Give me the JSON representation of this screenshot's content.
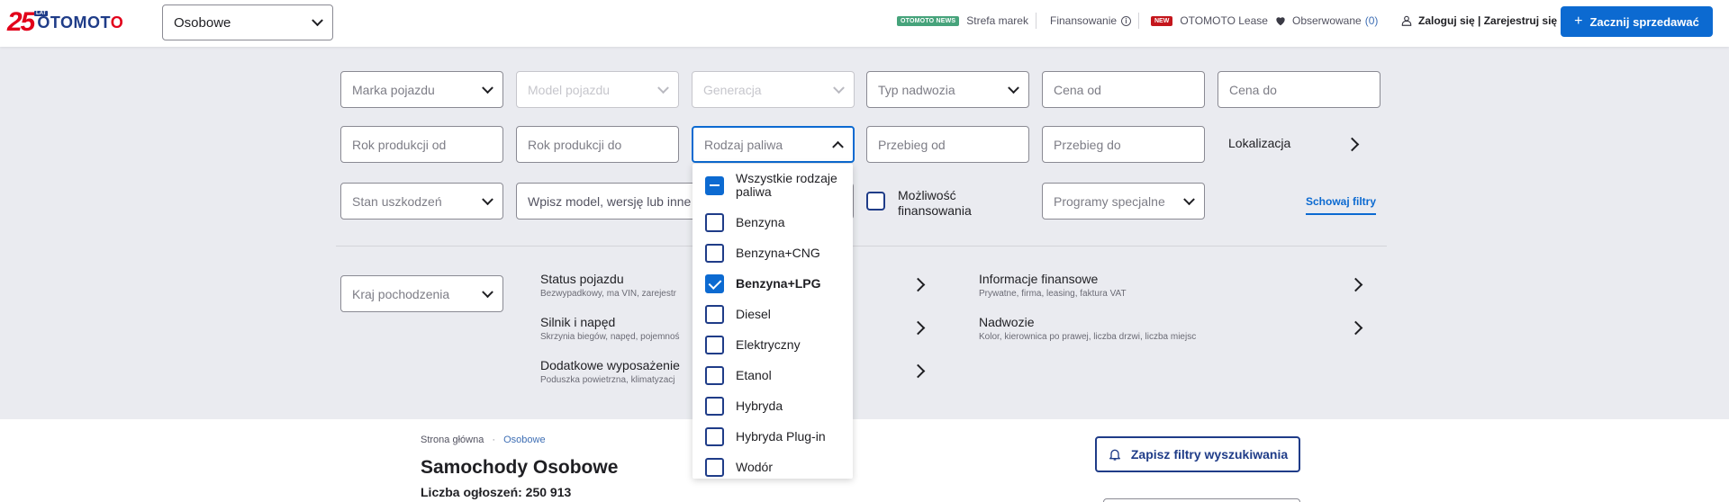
{
  "header": {
    "logo": {
      "anniversary": "25",
      "badge": "LAT",
      "brand_a": "OTOMOT",
      "brand_b": "O"
    },
    "category_select": "Osobowe",
    "news_badge": "OTOMOTO NEWS",
    "brand_zone": "Strefa marek",
    "financing": "Finansowanie",
    "new_badge": "NEW",
    "lease": "OTOMOTO Lease",
    "observed": "Obserwowane",
    "observed_count": "(0)",
    "login": "Zaloguj się | Zarejestruj się",
    "sell_button": "Zacznij sprzedawać",
    "colors": {
      "primary": "#0c6ad1",
      "brand_red": "#e2001a",
      "brand_blue": "#1f3c88"
    }
  },
  "filters": {
    "make": "Marka pojazdu",
    "model": "Model pojazdu",
    "generation": "Generacja",
    "body_type": "Typ nadwozia",
    "price_from": "Cena od",
    "price_to": "Cena do",
    "year_from": "Rok produkcji od",
    "year_to": "Rok produkcji do",
    "fuel": "Rodzaj paliwa",
    "mileage_from": "Przebieg od",
    "mileage_to": "Przebieg do",
    "location": "Lokalizacja",
    "damage": "Stan uszkodzeń",
    "search": "Wpisz model, wersję lub inne",
    "financing_option": "Możliwość finansowania",
    "special_programs": "Programy specjalne",
    "hide_filters": "Schowaj filtry",
    "origin_country": "Kraj pochodzenia"
  },
  "groups": [
    {
      "title": "Status pojazdu",
      "sub": "Bezwypadkowy, ma VIN, zarejestr"
    },
    {
      "title": "Silnik i napęd",
      "sub": "Skrzynia biegów, napęd, pojemnoś"
    },
    {
      "title": "Dodatkowe wyposażenie",
      "sub": "Poduszka powietrzna, klimatyzacj"
    },
    {
      "title": "Informacje finansowe",
      "sub": "Prywatne, firma, leasing, faktura VAT"
    },
    {
      "title": "Nadwozie",
      "sub": "Kolor, kierownica po prawej, liczba drzwi, liczba miejsc"
    }
  ],
  "fuel_dropdown": {
    "items": [
      {
        "label": "Wszystkie rodzaje paliwa",
        "state": "indeterminate"
      },
      {
        "label": "Benzyna",
        "state": "unchecked"
      },
      {
        "label": "Benzyna+CNG",
        "state": "unchecked"
      },
      {
        "label": "Benzyna+LPG",
        "state": "checked"
      },
      {
        "label": "Diesel",
        "state": "unchecked"
      },
      {
        "label": "Elektryczny",
        "state": "unchecked"
      },
      {
        "label": "Etanol",
        "state": "unchecked"
      },
      {
        "label": "Hybryda",
        "state": "unchecked"
      },
      {
        "label": "Hybryda Plug-in",
        "state": "unchecked"
      },
      {
        "label": "Wodór",
        "state": "unchecked"
      }
    ]
  },
  "breadcrumb": {
    "home": "Strona główna",
    "separator": "·",
    "current": "Osobowe"
  },
  "results": {
    "title": "Samochody Osobowe",
    "count_label": "Liczba ogłoszeń: 250 913",
    "save_filters": "Zapisz filtry wyszukiwania"
  }
}
